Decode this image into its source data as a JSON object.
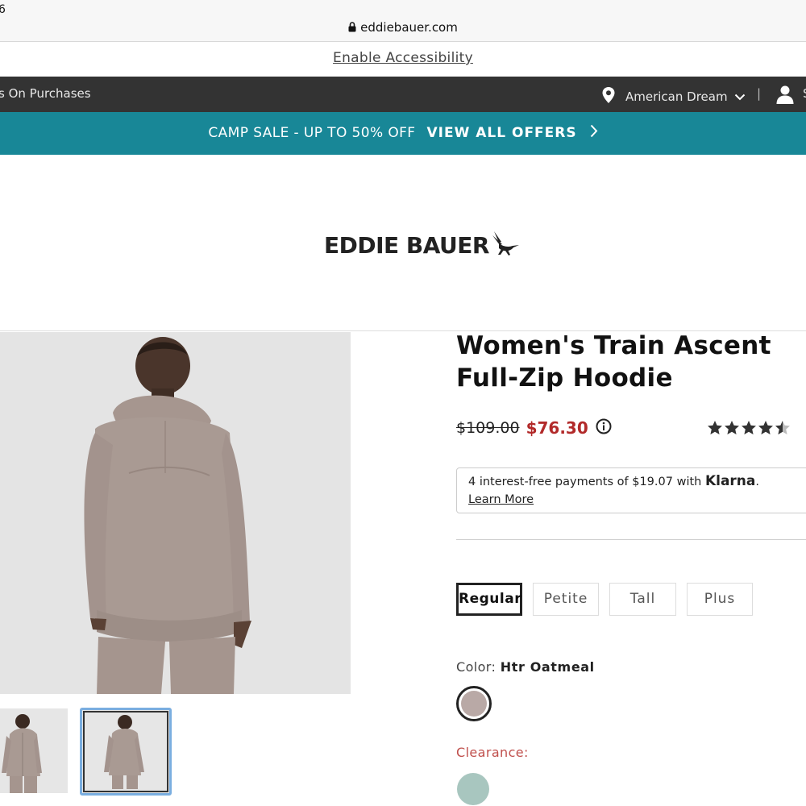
{
  "browser": {
    "time_fragment": "6",
    "url": "eddiebauer.com"
  },
  "accessibility": {
    "link_label": "Enable Accessibility"
  },
  "utility_bar": {
    "promo_text": "s On Purchases",
    "store_name": "American Dream",
    "divider": "|",
    "account_fragment": "S"
  },
  "offer_banner": {
    "sale_text": "CAMP SALE - UP TO 50% OFF",
    "link_label": "VIEW ALL OFFERS"
  },
  "brand": {
    "logo_text": "EDDIE BAUER"
  },
  "product": {
    "title": "Women's Train Ascent Full-Zip Hoodie",
    "original_price": "$109.00",
    "sale_price": "$76.30",
    "rating": 4.5,
    "rating_max": 5,
    "klarna": {
      "text": "4 interest-free payments of $19.07 with ",
      "brand": "Klarna",
      "suffix": ".",
      "learn_more": "Learn More"
    },
    "fits": [
      {
        "label": "Regular",
        "selected": true
      },
      {
        "label": "Petite",
        "selected": false
      },
      {
        "label": "Tall",
        "selected": false
      },
      {
        "label": "Plus",
        "selected": false
      }
    ],
    "color_label": "Color:",
    "color_value": "Htr Oatmeal",
    "selected_swatch_color": "#b9a9a6",
    "clearance_label": "Clearance:",
    "clearance_swatch_color": "#a8c6bf"
  },
  "colors": {
    "offer_teal": "#188797",
    "utility_dark": "#333333",
    "sale_red": "#b22a2a",
    "clearance_red": "#c0504d",
    "thumb_highlight": "#7aaee0"
  },
  "icons": {
    "lock": "lock-icon",
    "pin": "location-pin-icon",
    "chevron_down": "chevron-down-icon",
    "user": "user-icon",
    "chevron_right": "chevron-right-icon",
    "info": "info-icon",
    "star": "star-icon",
    "bird": "heron-logo-icon"
  }
}
